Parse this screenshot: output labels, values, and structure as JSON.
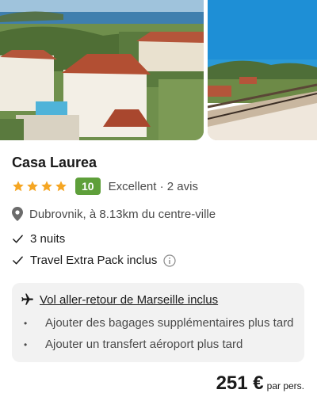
{
  "hotel": {
    "name": "Casa Laurea",
    "stars": 4,
    "score": "10",
    "rating_label": "Excellent · 2 avis",
    "location": "Dubrovnik, à 8.13km du centre-ville"
  },
  "features": {
    "nights": "3 nuits",
    "pack": "Travel Extra Pack inclus"
  },
  "flight_box": {
    "flight": "Vol aller-retour de Marseille inclus",
    "extras": [
      "Ajouter des bagages supplémentaires plus tard",
      "Ajouter un transfert aéroport plus tard"
    ]
  },
  "price": {
    "amount": "251 €",
    "unit": "par pers."
  },
  "colors": {
    "star": "#f5a623",
    "score_badge": "#5e9f3a"
  },
  "icons": {
    "location": "map-pin-icon",
    "check": "checkmark-icon",
    "info": "info-circle-icon",
    "flight": "airplane-icon",
    "bullet": "dot-icon"
  }
}
